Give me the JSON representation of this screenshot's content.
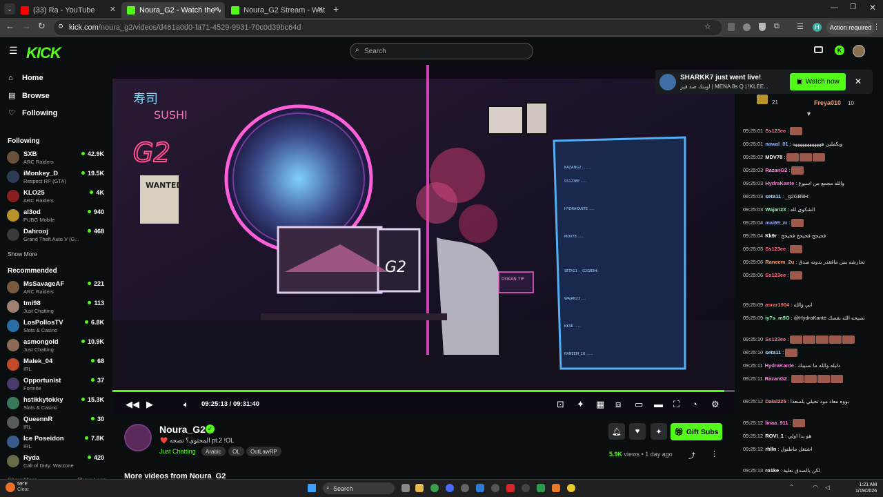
{
  "browser": {
    "tabs": [
      {
        "title": "(33) Ra - YouTube",
        "color": "#ff0000",
        "active": false
      },
      {
        "title": "Noura_G2 - Watch the VOD on",
        "color": "#53fc18",
        "active": true
      },
      {
        "title": "Noura_G2 Stream - Watch Live",
        "color": "#53fc18",
        "active": false
      }
    ],
    "url_domain": "kick.com",
    "url_path": "/noura_g2/videos/d461a0d0-fa71-4529-9931-70c0d39bc64d",
    "action_required": "Action required"
  },
  "header": {
    "logo": "KICK",
    "search_placeholder": "Search"
  },
  "sidebar": {
    "nav": [
      {
        "label": "Home",
        "icon": "home-icon",
        "glyph": "⌂"
      },
      {
        "label": "Browse",
        "icon": "browse-icon",
        "glyph": "▤"
      },
      {
        "label": "Following",
        "icon": "heart-icon",
        "glyph": "♡"
      }
    ],
    "following_title": "Following",
    "following": [
      {
        "name": "SXB",
        "category": "ARC Raiders",
        "viewers": "42.9K",
        "color": "#6a4f3a"
      },
      {
        "name": "iMonkey_D",
        "category": "Respect RP (GTA)",
        "viewers": "19.5K",
        "color": "#2d3b55"
      },
      {
        "name": "KLO25",
        "category": "ARC Raiders",
        "viewers": "4K",
        "color": "#8a1f1f"
      },
      {
        "name": "al3od",
        "category": "PUBG Mobile",
        "viewers": "940",
        "color": "#b8922b"
      },
      {
        "name": "Dahrooj",
        "category": "Grand Theft Auto V (G...",
        "viewers": "468",
        "color": "#3a3a3a"
      }
    ],
    "show_more": "Show More",
    "recommended_title": "Recommended",
    "recommended": [
      {
        "name": "MsSavageAF",
        "category": "ARC Raiders",
        "viewers": "221",
        "color": "#7a5a3c"
      },
      {
        "name": "tmi98",
        "category": "Just Chatting",
        "viewers": "113",
        "color": "#a08070"
      },
      {
        "name": "LosPollosTV",
        "category": "Slots & Casino",
        "viewers": "6.8K",
        "color": "#2a6fa8"
      },
      {
        "name": "asmongold",
        "category": "Just Chatting",
        "viewers": "10.9K",
        "color": "#8c6a58"
      },
      {
        "name": "Malek_04",
        "category": "IRL",
        "viewers": "68",
        "color": "#c04a2a"
      },
      {
        "name": "Opportunist",
        "category": "Fortnite",
        "viewers": "37",
        "color": "#4a3a6a"
      },
      {
        "name": "hstikkytokky",
        "category": "Slots & Casino",
        "viewers": "15.3K",
        "color": "#3a7a5a"
      },
      {
        "name": "QueennR",
        "category": "IRL",
        "viewers": "30",
        "color": "#5a5a5a"
      },
      {
        "name": "Ice Poseidon",
        "category": "IRL",
        "viewers": "7.8K",
        "color": "#3a5a8a"
      },
      {
        "name": "Ryda",
        "category": "Call of Duty: Warzone",
        "viewers": "420",
        "color": "#6a6a4a"
      }
    ],
    "show_more_2": "Show More",
    "show_less": "Show Less"
  },
  "player": {
    "current_time": "09:25:13",
    "separator": "/",
    "duration": "09:31:40",
    "progress": 0.983
  },
  "video_info": {
    "channel": "Noura_G2",
    "title": "❤️ المحتوى؟ نصحه pt.2 !OL",
    "category": "Just Chatting",
    "tags": [
      "Arabic",
      "OL",
      "OutLawRP"
    ],
    "gift_subs": "Gift Subs",
    "views_count": "5.9K",
    "views_label": "views",
    "dot": "•",
    "age": "1 day ago",
    "more_videos": "More videos from Noura_G2"
  },
  "notification": {
    "title": "SHARKK7 just went live!",
    "subtitle": "اوبنك ضد فيز | MENA 8s Q | !KLEE...",
    "watch_now": "Watch now"
  },
  "chat": {
    "top_count_1": "21",
    "top_user": "Freya010",
    "top_count_2": "10",
    "messages": [
      {
        "time": "09:25:01",
        "user": "Ss123ee",
        "text": "",
        "color": "#ff6b8a",
        "emotes": 1
      },
      {
        "time": "09:25:01",
        "user": "nawal_01",
        "text": "وبكملين ههههههههههههه",
        "color": "#8fb8ff",
        "emotes": 0
      },
      {
        "time": "09:25:02",
        "user": "MDV78",
        "text": "",
        "color": "#ffffff",
        "emotes": 3
      },
      {
        "time": "09:25:03",
        "user": "RazanG2",
        "text": "",
        "color": "#ff8ad8",
        "emotes": 1
      },
      {
        "time": "09:25:03",
        "user": "HydraKante",
        "text": "والله مجمع من اسبوع",
        "color": "#ff7ad9",
        "emotes": 0
      },
      {
        "time": "09:25:03",
        "user": "seta11",
        "text": "_g2GB9H:",
        "color": "#b8e0ff",
        "emotes": 0
      },
      {
        "time": "09:25:03",
        "user": "Wajan23",
        "text": "الشكوى لله",
        "color": "#8ff0b0",
        "emotes": 0
      },
      {
        "time": "09:25:04",
        "user": "mai69_m",
        "text": "",
        "color": "#8fa0ff",
        "emotes": 1
      },
      {
        "time": "09:25:04",
        "user": "Kk9r",
        "text": "فحيحح فحيحح فحيحح",
        "color": "#ffffff",
        "emotes": 0
      },
      {
        "time": "09:25:05",
        "user": "Ss123ee",
        "text": "",
        "color": "#ff6b8a",
        "emotes": 1
      },
      {
        "time": "09:25:06",
        "user": "Raneem_2u",
        "text": "تحارشه بس مافقدر بدونه صدق",
        "color": "#ff9a6b",
        "emotes": 0
      },
      {
        "time": "09:25:06",
        "user": "Ss123ee",
        "text": "",
        "color": "#ff6b8a",
        "emotes": 1
      },
      {
        "time": "09:25:09",
        "user": "asrar1904",
        "text": "ابي والله",
        "color": "#ff6b6b",
        "emotes": 0
      },
      {
        "time": "09:25:09",
        "user": "iy7s_m9O",
        "text": "@HydraKante نصيحه الله نفسك",
        "color": "#8ff0b0",
        "emotes": 0
      },
      {
        "time": "09:25:10",
        "user": "Ss123ee",
        "text": "",
        "color": "#ff6b8a",
        "emotes": 5
      },
      {
        "time": "09:25:10",
        "user": "seta11",
        "text": "",
        "color": "#b8e0ff",
        "emotes": 1
      },
      {
        "time": "09:25:11",
        "user": "HydraKante",
        "text": "دليله والله ما تسيبك",
        "color": "#ff7ad9",
        "emotes": 0
      },
      {
        "time": "09:25:11",
        "user": "RazanG2",
        "text": "",
        "color": "#ff8ad8",
        "emotes": 4
      },
      {
        "time": "09:25:12",
        "user": "Dalal225",
        "text": "بووه معاد مود تخيلي بلسعدا",
        "color": "#ff8a8a",
        "emotes": 0
      },
      {
        "time": "09:25:12",
        "user": "linaa_911",
        "text": "",
        "color": "#ff8ad8",
        "emotes": 1
      },
      {
        "time": "09:25:12",
        "user": "ROVI_1",
        "text": "هو بدا اولي",
        "color": "#ffffff",
        "emotes": 0
      },
      {
        "time": "09:25:12",
        "user": "rhlln",
        "text": "اشتغل ماطنول",
        "color": "#ffffff",
        "emotes": 0
      },
      {
        "time": "09:25:13",
        "user": "ro1ke",
        "text": "لكن بالصدق نعلية",
        "color": "#ffffff",
        "emotes": 0
      }
    ]
  },
  "taskbar": {
    "search": "Search",
    "time": "1:21 AM",
    "date": "1/19/2026",
    "temp": "59°F",
    "weather": "Clear"
  }
}
